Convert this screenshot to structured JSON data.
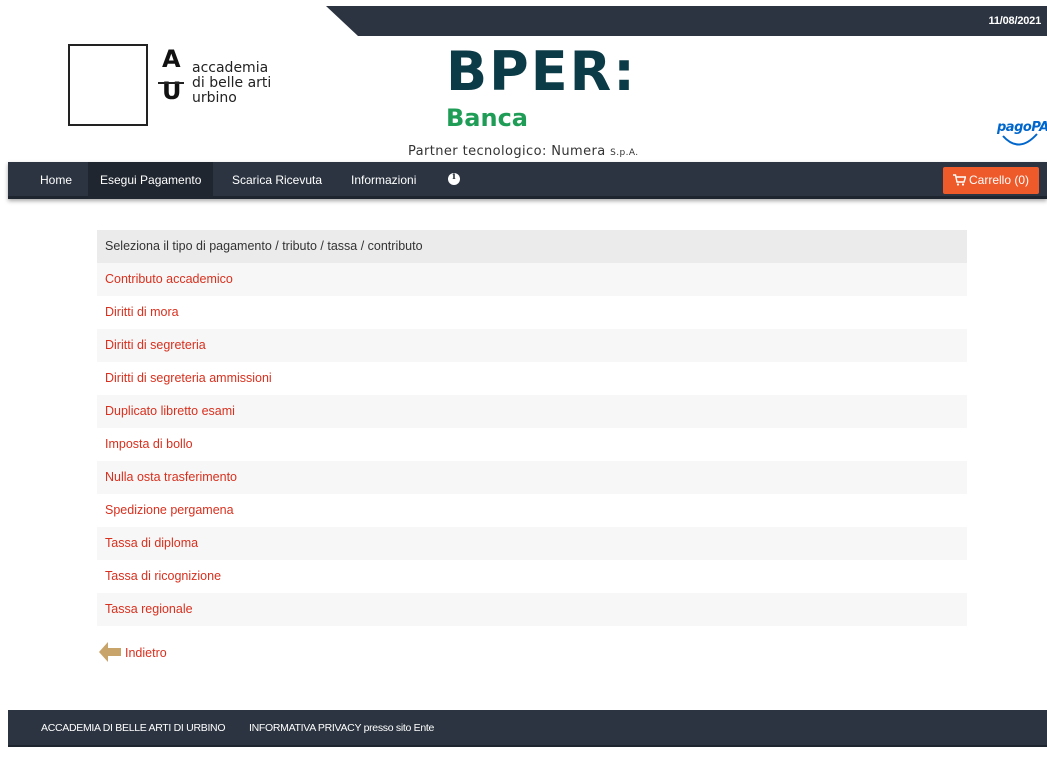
{
  "topbar": {
    "date": "11/08/2021",
    "color": "#2b3440"
  },
  "header": {
    "aba_logo": {
      "letter_top": "A",
      "letter_bottom": "U",
      "line1": "accademia",
      "line2": "di belle arti",
      "line3": "urbino"
    },
    "bper_logo": {
      "word": "BPER:",
      "sub": "Banca"
    },
    "partner": {
      "text": "Partner tecnologico: Numera",
      "suffix": "S.p.A."
    },
    "pagopa": "pagoPA"
  },
  "nav": {
    "items": [
      {
        "label": "Home"
      },
      {
        "label": "Esegui Pagamento",
        "active": true
      },
      {
        "label": "Scarica Ricevuta"
      },
      {
        "label": "Informazioni"
      }
    ],
    "cart": "Carrello (0)",
    "cart_color": "#ef5a2a"
  },
  "payments": {
    "heading": "Seleziona il tipo di pagamento / tributo / tassa / contributo",
    "items": [
      "Contributo accademico",
      "Diritti di mora",
      "Diritti di segreteria",
      "Diritti di segreteria ammissioni",
      "Duplicato libretto esami",
      "Imposta di bollo",
      "Nulla osta trasferimento",
      "Spedizione pergamena",
      "Tassa di diploma",
      "Tassa di ricognizione",
      "Tassa regionale"
    ],
    "link_color": "#d9301e"
  },
  "back": {
    "label": "Indietro",
    "icon": "arrow-left-icon"
  },
  "footer": {
    "institution": "ACCADEMIA DI BELLE ARTI DI URBINO",
    "privacy": "INFORMATIVA PRIVACY presso sito Ente"
  }
}
